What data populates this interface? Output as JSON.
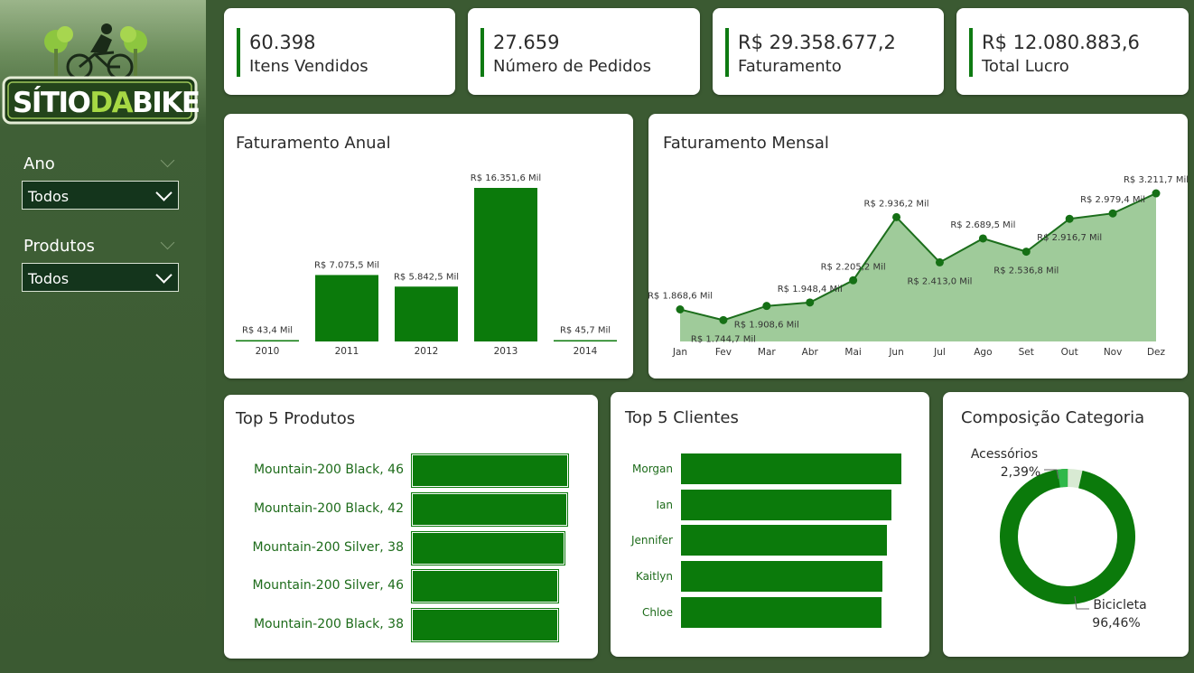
{
  "brand": {
    "logo_text_1": "SÍTIO",
    "logo_text_2": "DA",
    "logo_text_3": "BIKE"
  },
  "filters": [
    {
      "label": "Ano",
      "value": "Todos"
    },
    {
      "label": "Produtos",
      "value": "Todos"
    }
  ],
  "kpis": [
    {
      "value": "60.398",
      "label": "Itens Vendidos"
    },
    {
      "value": "27.659",
      "label": "Número de Pedidos"
    },
    {
      "value": "R$ 29.358.677,2",
      "label": "Faturamento"
    },
    {
      "value": "R$ 12.080.883,6",
      "label": "Total Lucro"
    }
  ],
  "colors": {
    "accent": "#0b7a0b",
    "area": "#9fcb9a",
    "sidebar": "#3b5a32",
    "donut_small": "#2fb84a"
  },
  "chart_data": [
    {
      "type": "bar",
      "title": "Faturamento Anual",
      "categories": [
        "2010",
        "2011",
        "2012",
        "2013",
        "2014"
      ],
      "values": [
        43.4,
        7075.5,
        5842.5,
        16351.6,
        45.7
      ],
      "data_labels": [
        "R$ 43,4 Mil",
        "R$ 7.075,5 Mil",
        "R$ 5.842,5 Mil",
        "R$ 16.351,6 Mil",
        "R$ 45,7 Mil"
      ],
      "ylim": [
        0,
        16351.6
      ]
    },
    {
      "type": "area",
      "title": "Faturamento Mensal",
      "categories": [
        "Jan",
        "Fev",
        "Mar",
        "Abr",
        "Mai",
        "Jun",
        "Jul",
        "Ago",
        "Set",
        "Out",
        "Nov",
        "Dez"
      ],
      "values": [
        1868.6,
        1744.7,
        1908.6,
        1948.4,
        2205.2,
        2936.2,
        2413.0,
        2689.5,
        2536.8,
        2916.7,
        2979.4,
        3211.7
      ],
      "data_labels": [
        "R$ 1.868,6 Mil",
        "R$ 1.744,7 Mil",
        "R$ 1.908,6 Mil",
        "R$ 1.948,4 Mil",
        "R$ 2.205,2 Mil",
        "R$ 2.936,2 Mil",
        "R$ 2.413,0 Mil",
        "R$ 2.689,5 Mil",
        "R$ 2.536,8 Mil",
        "R$ 2.916,7 Mil",
        "R$ 2.979,4 Mil",
        "R$ 3.211,7 Mil"
      ]
    },
    {
      "type": "bar",
      "title": "Top 5 Produtos",
      "categories": [
        "Mountain-200 Black, 46",
        "Mountain-200 Black, 42",
        "Mountain-200 Silver, 38",
        "Mountain-200 Silver, 46",
        "Mountain-200 Black, 38"
      ],
      "values": [
        100,
        99.5,
        97.6,
        93.9,
        93.5
      ]
    },
    {
      "type": "bar",
      "title": "Top 5 Clientes",
      "categories": [
        "Morgan",
        "Ian",
        "Jennifer",
        "Kaitlyn",
        "Chloe"
      ],
      "values": [
        100,
        95.5,
        93.4,
        91.4,
        91.0
      ]
    },
    {
      "type": "pie",
      "title": "Composição Categoria",
      "categories": [
        "Bicicleta",
        "Acessórios"
      ],
      "values": [
        96.46,
        2.39
      ],
      "data_labels": [
        "96,46%",
        "2,39%"
      ]
    }
  ]
}
